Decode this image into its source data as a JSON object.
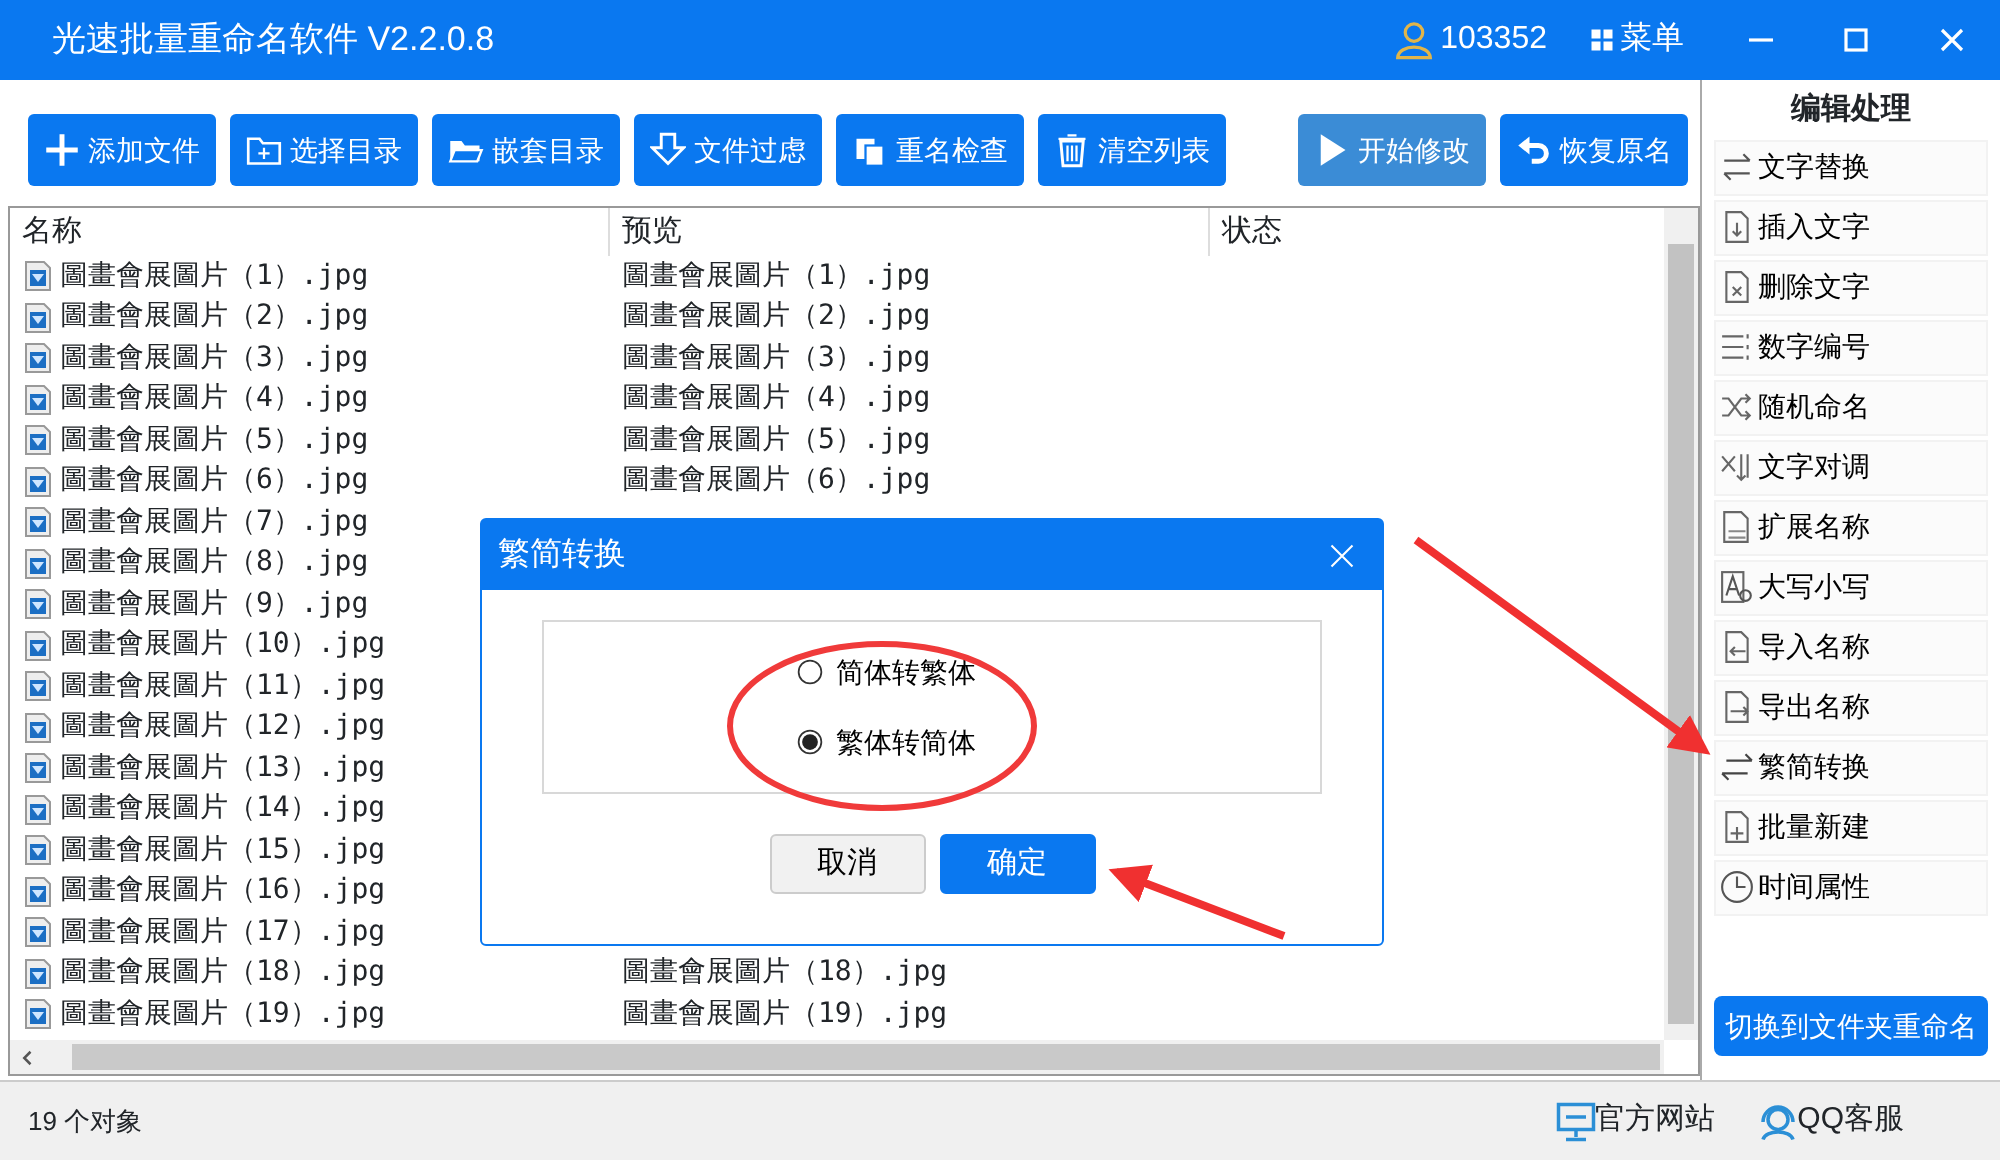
{
  "window": {
    "title": "光速批量重命名软件 V2.2.0.8",
    "user_id": "103352",
    "menu_label": "菜单"
  },
  "toolbar": [
    {
      "label": "添加文件",
      "disabled": false
    },
    {
      "label": "选择目录",
      "disabled": false
    },
    {
      "label": "嵌套目录",
      "disabled": false
    },
    {
      "label": "文件过虑",
      "disabled": false
    },
    {
      "label": "重名检查",
      "disabled": false
    },
    {
      "label": "清空列表",
      "disabled": false
    }
  ],
  "actions": [
    {
      "label": "开始修改",
      "disabled": true
    },
    {
      "label": "恢复原名",
      "disabled": false
    }
  ],
  "table": {
    "columns": [
      "名称",
      "预览",
      "状态"
    ],
    "rows": [
      {
        "name": "圖畫會展圖片（1）.jpg",
        "preview": "圖畫會展圖片（1）.jpg"
      },
      {
        "name": "圖畫會展圖片（2）.jpg",
        "preview": "圖畫會展圖片（2）.jpg"
      },
      {
        "name": "圖畫會展圖片（3）.jpg",
        "preview": "圖畫會展圖片（3）.jpg"
      },
      {
        "name": "圖畫會展圖片（4）.jpg",
        "preview": "圖畫會展圖片（4）.jpg"
      },
      {
        "name": "圖畫會展圖片（5）.jpg",
        "preview": "圖畫會展圖片（5）.jpg"
      },
      {
        "name": "圖畫會展圖片（6）.jpg",
        "preview": "圖畫會展圖片（6）.jpg"
      },
      {
        "name": "圖畫會展圖片（7）.jpg"
      },
      {
        "name": "圖畫會展圖片（8）.jpg"
      },
      {
        "name": "圖畫會展圖片（9）.jpg"
      },
      {
        "name": "圖畫會展圖片（10）.jpg"
      },
      {
        "name": "圖畫會展圖片（11）.jpg"
      },
      {
        "name": "圖畫會展圖片（12）.jpg"
      },
      {
        "name": "圖畫會展圖片（13）.jpg"
      },
      {
        "name": "圖畫會展圖片（14）.jpg"
      },
      {
        "name": "圖畫會展圖片（15）.jpg"
      },
      {
        "name": "圖畫會展圖片（16）.jpg"
      },
      {
        "name": "圖畫會展圖片（17）.jpg"
      },
      {
        "name": "圖畫會展圖片（18）.jpg",
        "preview": "圖畫會展圖片（18）.jpg"
      },
      {
        "name": "圖畫會展圖片（19）.jpg",
        "preview": "圖畫會展圖片（19）.jpg"
      }
    ]
  },
  "sidebar": {
    "title": "编辑处理",
    "items": [
      {
        "label": "文字替换"
      },
      {
        "label": "插入文字"
      },
      {
        "label": "删除文字"
      },
      {
        "label": "数字编号"
      },
      {
        "label": "随机命名"
      },
      {
        "label": "文字对调"
      },
      {
        "label": "扩展名称"
      },
      {
        "label": "大写小写"
      },
      {
        "label": "导入名称"
      },
      {
        "label": "导出名称"
      },
      {
        "label": "繁简转换"
      },
      {
        "label": "批量新建"
      },
      {
        "label": "时间属性"
      }
    ],
    "button": "切换到文件夹重命名"
  },
  "status_bar": {
    "count": "19 个对象",
    "links": [
      "官方网站",
      "QQ客服"
    ]
  },
  "dialog": {
    "title": "繁简转换",
    "options": [
      {
        "label": "简体转繁体",
        "selected": false
      },
      {
        "label": "繁体转简体",
        "selected": true
      }
    ],
    "buttons": [
      {
        "label": "取消",
        "kind": "secondary"
      },
      {
        "label": "确定",
        "kind": "primary"
      }
    ]
  }
}
